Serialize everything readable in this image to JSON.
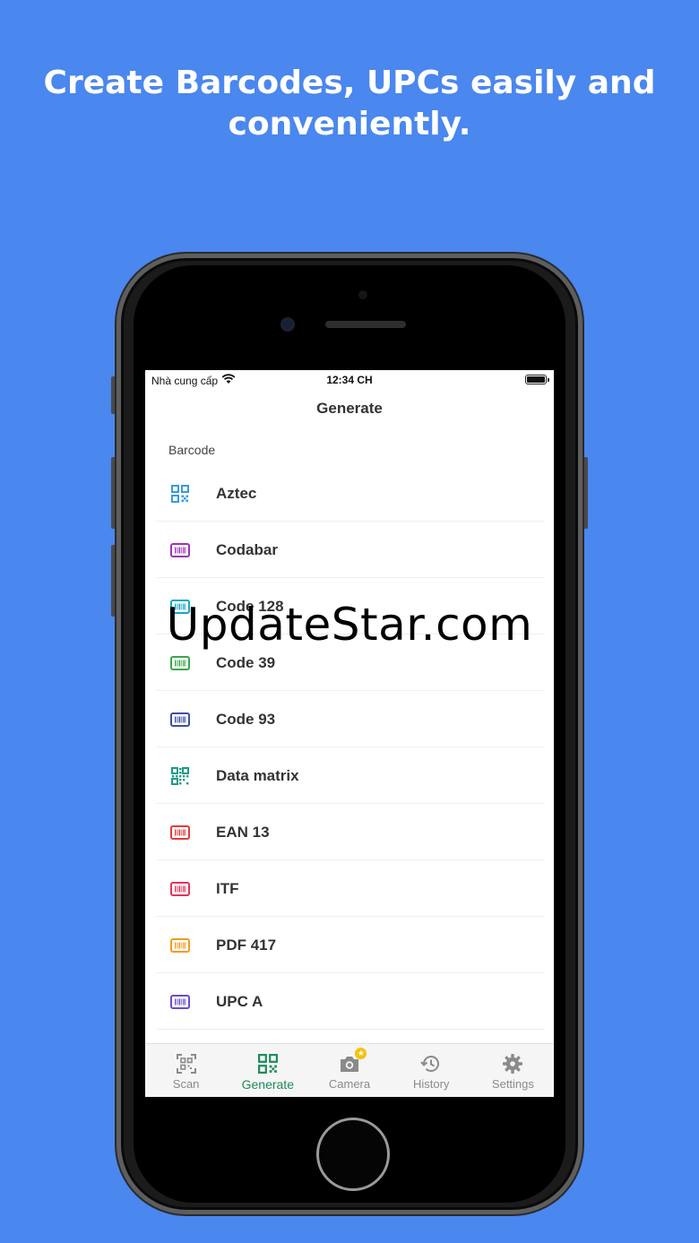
{
  "headline": "Create Barcodes, UPCs easily and conveniently.",
  "status_bar": {
    "carrier": "Nhà cung cấp",
    "time": "12:34 CH"
  },
  "nav": {
    "title": "Generate"
  },
  "section": {
    "label": "Barcode"
  },
  "items": [
    {
      "label": "Aztec",
      "icon": "qr-grid-icon",
      "color": "#3a9ae0"
    },
    {
      "label": "Codabar",
      "icon": "barcode-icon",
      "color": "#9c33b8"
    },
    {
      "label": "Code 128",
      "icon": "barcode-icon",
      "color": "#17a7c4"
    },
    {
      "label": "Code 39",
      "icon": "barcode-icon",
      "color": "#3aa64d"
    },
    {
      "label": "Code 93",
      "icon": "barcode-icon",
      "color": "#3b4fa6"
    },
    {
      "label": "Data matrix",
      "icon": "data-matrix-icon",
      "color": "#1b9a85"
    },
    {
      "label": "EAN 13",
      "icon": "barcode-icon",
      "color": "#e23c3c"
    },
    {
      "label": "ITF",
      "icon": "barcode-icon",
      "color": "#e0345a"
    },
    {
      "label": "PDF 417",
      "icon": "barcode-icon",
      "color": "#f39b1c"
    },
    {
      "label": "UPC A",
      "icon": "barcode-icon",
      "color": "#6a4bd0"
    }
  ],
  "tabs": [
    {
      "label": "Scan",
      "icon": "scan-icon",
      "active": false
    },
    {
      "label": "Generate",
      "icon": "qr-grid-icon",
      "active": true
    },
    {
      "label": "Camera",
      "icon": "camera-icon",
      "active": false
    },
    {
      "label": "History",
      "icon": "history-icon",
      "active": false
    },
    {
      "label": "Settings",
      "icon": "gear-icon",
      "active": false
    }
  ],
  "camera_badge": "★",
  "watermark": "UpdateStar.com",
  "colors": {
    "background": "#4a87ee",
    "active_tab": "#1e8c5a",
    "inactive_tab": "#8a8a8a"
  }
}
